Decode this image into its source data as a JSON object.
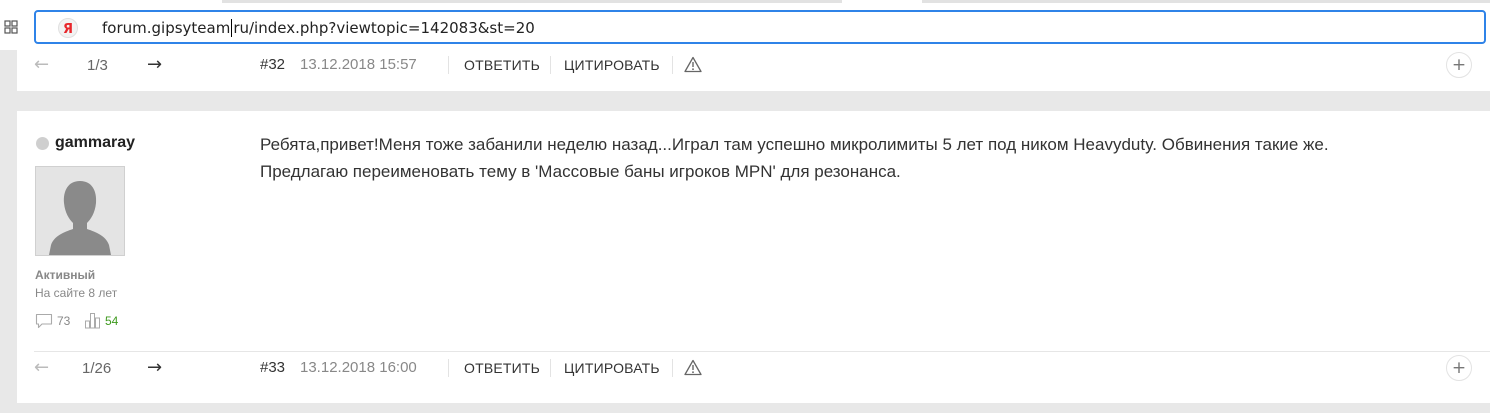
{
  "browser": {
    "url_host": "forum.gipsyteam",
    "url_rest": "ru/index.php?viewtopic=142083&st=20",
    "accent_color": "#2f83e8"
  },
  "top_bar": {
    "prev_arrow": "←",
    "page_count": "1/3",
    "next_arrow": "→",
    "post_number": "#32",
    "post_date": "13.12.2018 15:57",
    "reply_label": "ОТВЕТИТЬ",
    "quote_label": "ЦИТИРОВАТЬ",
    "report_icon": "warning-icon",
    "plus_label": "+"
  },
  "post": {
    "username": "gammaray",
    "status": "offline",
    "rank": "Активный",
    "member_since": "На сайте 8 лет",
    "posts_count": "73",
    "rating_count": "54",
    "rating_color": "#3f9a1f",
    "text_lines": [
      "Ребята,привет!Меня тоже забанили неделю назад...Играл там успешно микролимиты 5 лет под ником Heavyduty. Обвинения такие же.",
      "Предлагаю переименовать тему в 'Массовые баны игроков MPN' для резонанса."
    ]
  },
  "bottom_bar": {
    "prev_arrow": "←",
    "page_count": "1/26",
    "next_arrow": "→",
    "post_number": "#33",
    "post_date": "13.12.2018 16:00",
    "reply_label": "ОТВЕТИТЬ",
    "quote_label": "ЦИТИРОВАТЬ",
    "report_icon": "warning-icon",
    "plus_label": "+"
  }
}
